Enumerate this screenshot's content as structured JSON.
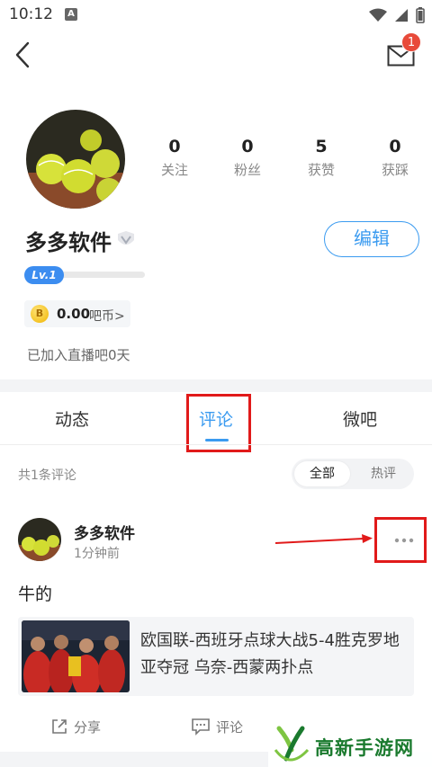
{
  "status_bar": {
    "time": "10:12",
    "notif_letter": "A"
  },
  "header": {
    "mail_badge": "1"
  },
  "profile": {
    "username": "多多软件",
    "edit_label": "编辑",
    "level": "Lv.1",
    "level_progress": 0,
    "coins_value": "0.00",
    "coins_unit": "吧币>",
    "joined_text": "已加入直播吧0天",
    "stats": [
      {
        "value": "0",
        "label": "关注"
      },
      {
        "value": "0",
        "label": "粉丝"
      },
      {
        "value": "5",
        "label": "获赞"
      },
      {
        "value": "0",
        "label": "获踩"
      }
    ]
  },
  "tabs": [
    {
      "label": "动态"
    },
    {
      "label": "评论"
    },
    {
      "label": "微吧"
    }
  ],
  "active_tab": "评论",
  "comments_section": {
    "count_text": "共1条评论",
    "filters": [
      "全部",
      "热评"
    ]
  },
  "comment": {
    "user": "多多软件",
    "time": "1分钟前",
    "text": "牛的",
    "link_title": "欧国联-西班牙点球大战5-4胜克罗地亚夺冠 乌奈-西蒙两扑点",
    "actions": [
      "分享",
      "评论"
    ]
  },
  "watermark": {
    "text": "高新手游网"
  },
  "colors": {
    "accent": "#3b9bf0",
    "highlight_box": "#e11a1a",
    "badge": "#e84a3a"
  }
}
